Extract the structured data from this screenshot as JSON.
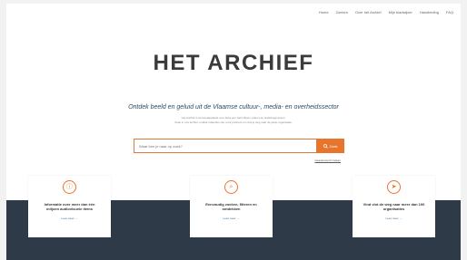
{
  "nav": [
    "Home",
    "Zoeken",
    "Over het Archief",
    "Mijn bladwijzer",
    "Handleiding",
    "FAQ"
  ],
  "logo": "HET ARCHIEF",
  "tagline": "Ontdek beeld en geluid uit de Vlaamse cultuur-, media- en overheidssector",
  "description": [
    "Het Archief is de bewaarplaats voor bijna een half miljoen video's en audiofragmenten.",
    "Zoek in ons archief, ontdek collecties van onze partners en vind je weg naar de juiste organisatie."
  ],
  "search": {
    "placeholder": "Waar ben je naar op zoek?",
    "button": "Zoek"
  },
  "advanced_link": "Geavanceerd zoeken",
  "cards": [
    {
      "title": "Informatie over meer dan één miljoen audiovisuele items",
      "link": "Lees meer →"
    },
    {
      "title": "Eenvoudig zoeken, filteren en ontdekken",
      "link": "Lees meer →"
    },
    {
      "title": "Vind vlot de weg naar meer dan 100 organisaties",
      "link": "Lees meer →"
    }
  ]
}
